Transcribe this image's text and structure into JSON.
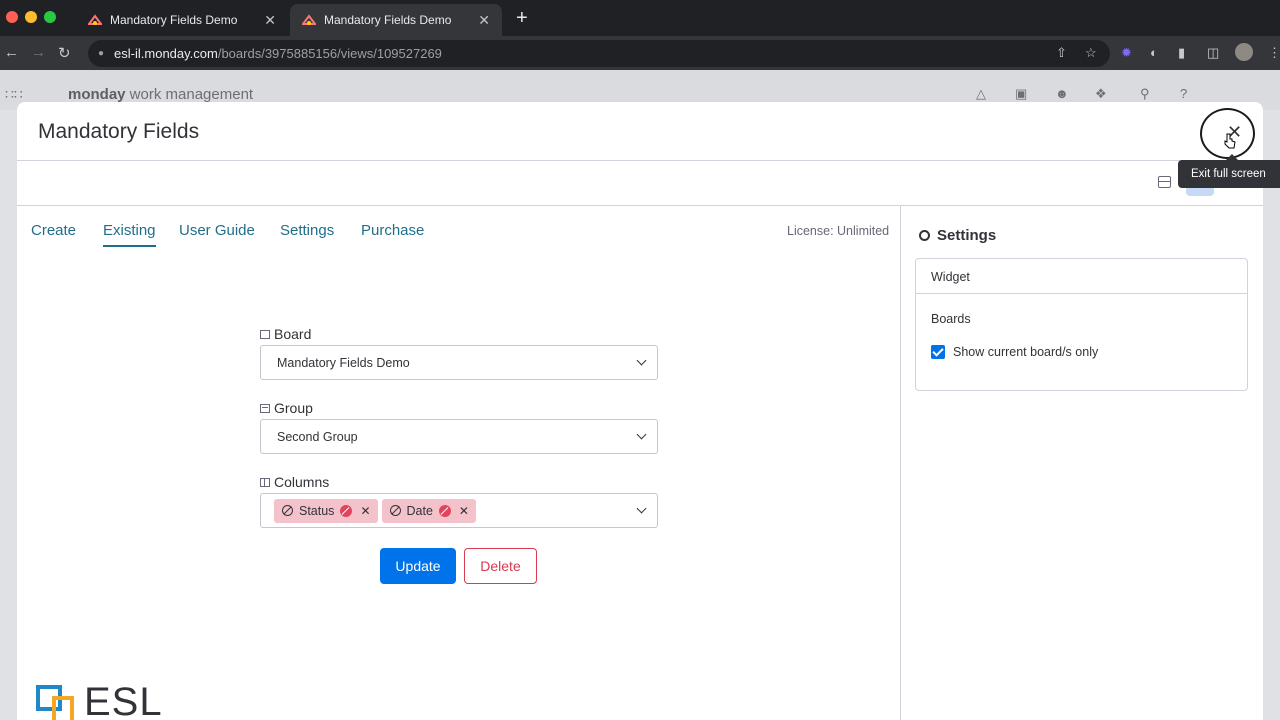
{
  "browser": {
    "tabs": [
      {
        "title": "Mandatory Fields Demo",
        "close": "✕"
      },
      {
        "title": "Mandatory Fields Demo",
        "close": "✕"
      }
    ],
    "new_tab": "+",
    "url_host": "esl-il.monday.com",
    "url_path": "/boards/3975885156/views/109527269"
  },
  "app": {
    "logo_bold": "monday",
    "logo_rest": " work management"
  },
  "modal": {
    "title": "Mandatory Fields",
    "close_tooltip": "Exit full screen",
    "nav": [
      "Create",
      "Existing",
      "User Guide",
      "Settings",
      "Purchase"
    ],
    "active_tab": "Existing",
    "license": "License: Unlimited",
    "form": {
      "board_label": "Board",
      "board_value": "Mandatory Fields Demo",
      "group_label": "Group",
      "group_value": "Second Group",
      "columns_label": "Columns",
      "columns_chips": [
        "Status",
        "Date"
      ],
      "update_label": "Update",
      "delete_label": "Delete"
    },
    "logo_text": "ESL",
    "settings": {
      "title": "Settings",
      "widget_label": "Widget",
      "boards_label": "Boards",
      "checkbox_label": "Show current board/s only",
      "checkbox_checked": true
    }
  },
  "colors": {
    "accent": "#0073ea",
    "link": "#1f6f8b",
    "danger": "#d83a52",
    "chip_bg": "#f3c2cb"
  }
}
